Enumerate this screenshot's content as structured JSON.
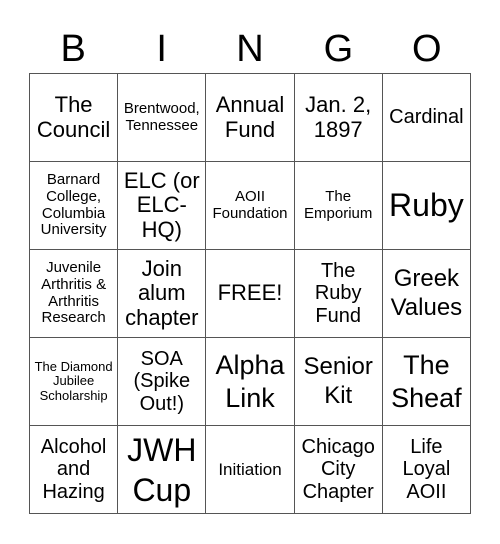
{
  "header": [
    "B",
    "I",
    "N",
    "G",
    "O"
  ],
  "cells": [
    [
      "The Council",
      "Brentwood, Tennessee",
      "Annual Fund",
      "Jan. 2, 1897",
      "Cardinal"
    ],
    [
      "Barnard College, Columbia University",
      "ELC (or ELC-HQ)",
      "AOII Foundation",
      "The Emporium",
      "Ruby"
    ],
    [
      "Juvenile Arthritis & Arthritis Research",
      "Join alum chapter",
      "FREE!",
      "The Ruby Fund",
      "Greek Values"
    ],
    [
      "The Diamond Jubilee Scholarship",
      "SOA (Spike Out!)",
      "Alpha Link",
      "Senior Kit",
      "The Sheaf"
    ],
    [
      "Alcohol and Hazing",
      "JWH Cup",
      "Initiation",
      "Chicago City Chapter",
      "Life Loyal AOII"
    ]
  ]
}
